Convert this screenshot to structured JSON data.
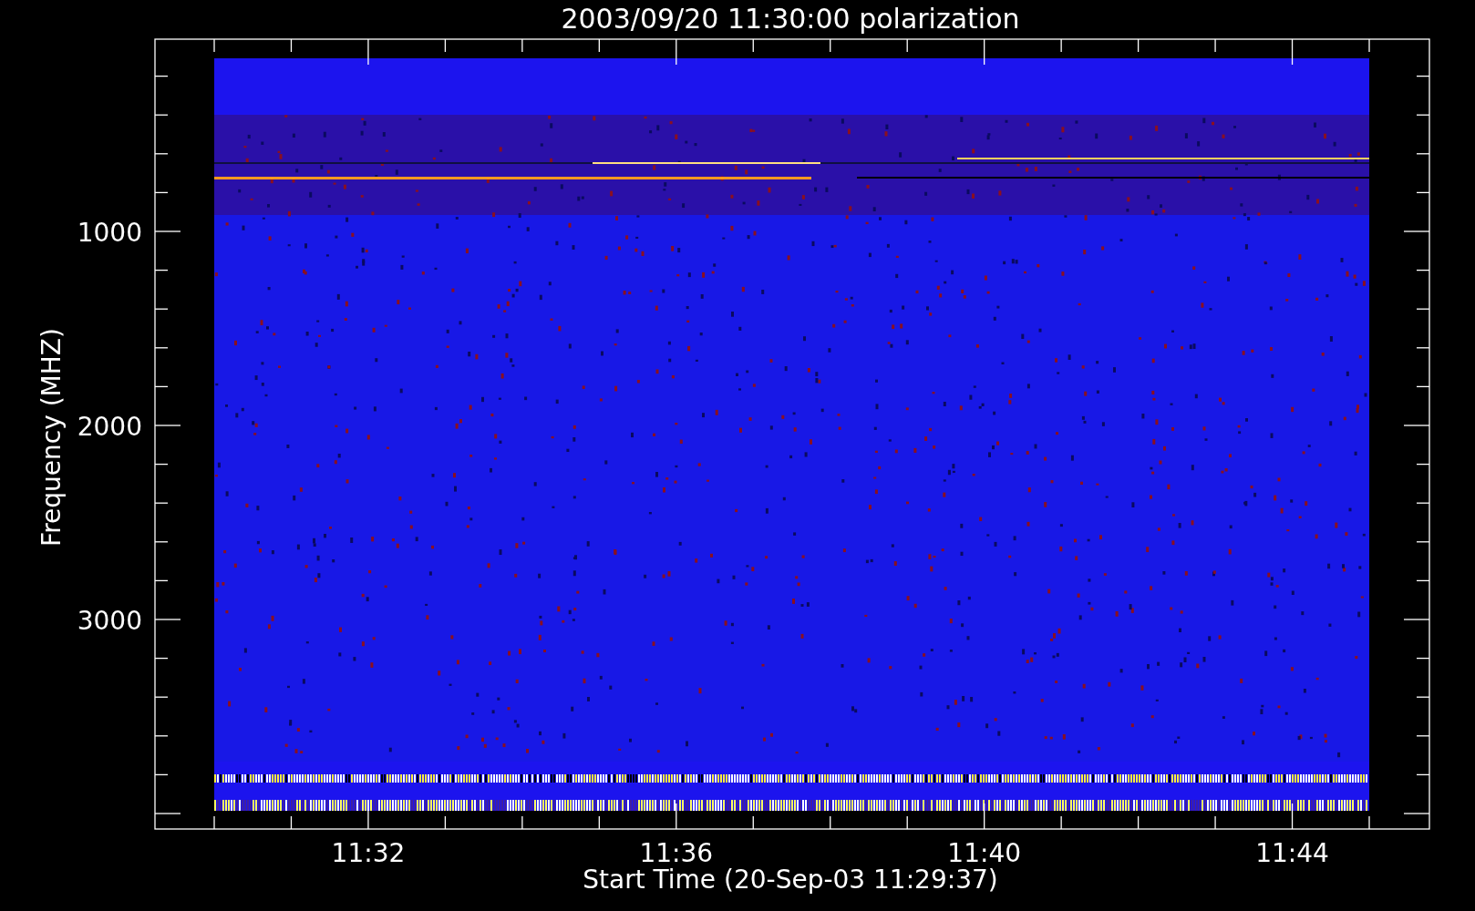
{
  "title": "2003/09/20 11:30:00 polarization",
  "y_axis": {
    "label": "Frequency (MHZ)",
    "ticks": [
      "1000",
      "2000",
      "3000"
    ]
  },
  "x_axis": {
    "label": "Start Time (20-Sep-03 11:29:37)",
    "ticks": [
      "11:32",
      "11:36",
      "11:40",
      "11:44"
    ]
  }
}
